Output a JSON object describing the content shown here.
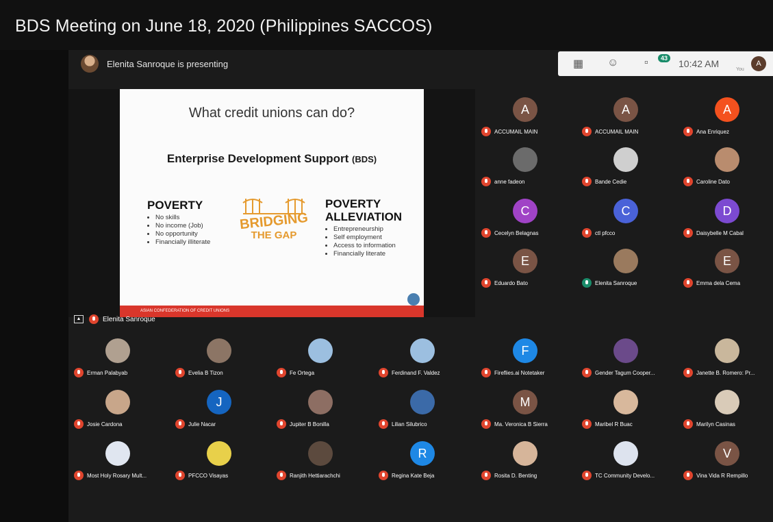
{
  "window": {
    "title": "BDS Meeting on June 18, 2020 (Philippines SACCOS)"
  },
  "presenting": {
    "text": "Elenita Sanroque is presenting"
  },
  "toolbar": {
    "time": "10:42 AM",
    "chat_badge": "43",
    "user_initial": "A",
    "you_label": "You"
  },
  "slide": {
    "title": "What credit unions can do?",
    "subtitle": "Enterprise Development Support",
    "subtitle_abbr": "(BDS)",
    "left_heading": "POVERTY",
    "left_items": [
      "No skills",
      "No income (Job)",
      "No opportunity",
      "Financially illiterate"
    ],
    "center_line1": "BRIDGING",
    "center_line2": "THE GAP",
    "right_heading_1": "POVERTY",
    "right_heading_2": "ALLEVIATION",
    "right_items": [
      "Entrepreneurship",
      "Self employment",
      "Access to information",
      "Financially literate"
    ],
    "footer": "ASIAN CONFEDERATION OF CREDIT UNIONS"
  },
  "stage_label": {
    "name": "Elenita Sanroque"
  },
  "participants": [
    {
      "name": "ACCUMAIL MAIN",
      "initial": "A",
      "color": "#7a5445"
    },
    {
      "name": "ACCUMAIL MAIN",
      "initial": "A",
      "color": "#7a5445"
    },
    {
      "name": "Ana Enriquez",
      "initial": "A",
      "color": "#f4511e"
    },
    {
      "name": "anne fadeon",
      "initial": "",
      "color": "#6b6b6b"
    },
    {
      "name": "Bande Cedie",
      "initial": "",
      "color": "#cfcfcf"
    },
    {
      "name": "Caroline Dato",
      "initial": "",
      "color": "#b98c6e"
    },
    {
      "name": "Cecelyn Belagnas",
      "initial": "C",
      "color": "#a043c6"
    },
    {
      "name": "ctl pfcco",
      "initial": "C",
      "color": "#4a62d8"
    },
    {
      "name": "Daisybelle M Cabal",
      "initial": "D",
      "color": "#7c4ad1"
    },
    {
      "name": "Eduardo Bato",
      "initial": "E",
      "color": "#7a5445"
    },
    {
      "name": "Elenita Sanroque",
      "initial": "",
      "color": "#9a7a5e"
    },
    {
      "name": "Emma dela Cema",
      "initial": "E",
      "color": "#7a5445"
    },
    {
      "name": "Erman Palabyab",
      "initial": "",
      "color": "#b0a090"
    },
    {
      "name": "Evelia B Tizon",
      "initial": "",
      "color": "#8c7565"
    },
    {
      "name": "Fe Ortega",
      "initial": "",
      "color": "#9cbfe0"
    },
    {
      "name": "Ferdinand F. Valdez",
      "initial": "",
      "color": "#9cbfe0"
    },
    {
      "name": "Fireflies.ai Notetaker",
      "initial": "F",
      "color": "#1e88e5"
    },
    {
      "name": "Gender Tagum Cooper...",
      "initial": "",
      "color": "#6b4a8a"
    },
    {
      "name": "Janette B. Romero: Pr...",
      "initial": "",
      "color": "#c9b79c"
    },
    {
      "name": "Josie Cardona",
      "initial": "",
      "color": "#c8a68a"
    },
    {
      "name": "Julie Nacar",
      "initial": "J",
      "color": "#1565c0"
    },
    {
      "name": "Jupiter B Bonilla",
      "initial": "",
      "color": "#8d6e63"
    },
    {
      "name": "Lilian Silubrico",
      "initial": "",
      "color": "#3b6aa8"
    },
    {
      "name": "Ma. Veronica B Sierra",
      "initial": "M",
      "color": "#7a5445"
    },
    {
      "name": "Maribel R Buac",
      "initial": "",
      "color": "#d8b89c"
    },
    {
      "name": "Marilyn Casinas",
      "initial": "",
      "color": "#d9cbb8"
    },
    {
      "name": "Most Holy Rosary Mult...",
      "initial": "",
      "color": "#e0e6f0"
    },
    {
      "name": "PFCCO Visayas",
      "initial": "",
      "color": "#e8d04a"
    },
    {
      "name": "Ranjith Hettiarachchi",
      "initial": "",
      "color": "#5c4a3e"
    },
    {
      "name": "Regina Kate Beja",
      "initial": "R",
      "color": "#1e88e5"
    },
    {
      "name": "Rosita D. Benting",
      "initial": "",
      "color": "#d6b59a"
    },
    {
      "name": "TC Community Develo...",
      "initial": "",
      "color": "#dde3ee"
    },
    {
      "name": "Vina Vida R Rempillo",
      "initial": "V",
      "color": "#7a5445"
    }
  ]
}
